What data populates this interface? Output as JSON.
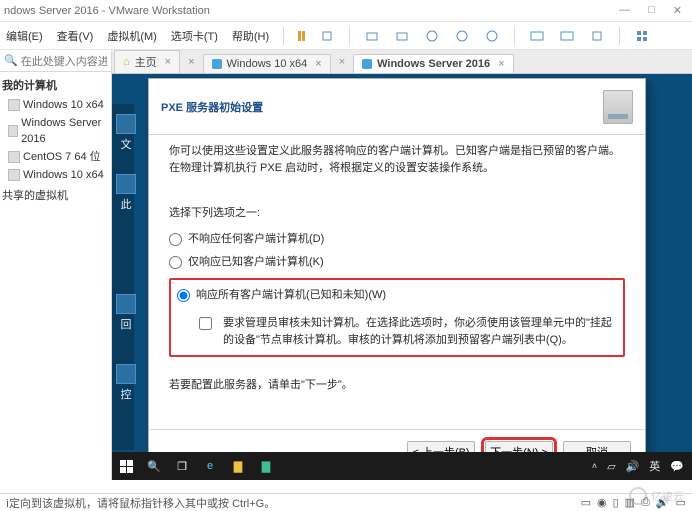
{
  "window": {
    "title": "ndows Server 2016 - VMware Workstation"
  },
  "menu": {
    "edit": "编辑(E)",
    "view": "查看(V)",
    "vm": "虚拟机(M)",
    "tabs": "选项卡(T)",
    "help": "帮助(H)"
  },
  "search": {
    "placeholder": "在此处键入内容进行搜索"
  },
  "tree": {
    "header": "我的计算机",
    "items": [
      {
        "label": "Windows 10 x64"
      },
      {
        "label": "Windows Server 2016"
      },
      {
        "label": "CentOS 7 64 位"
      },
      {
        "label": "Windows 10 x64"
      }
    ],
    "shared": "共享的虚拟机"
  },
  "tabs": {
    "home": "主页",
    "t1": "Windows 10 x64",
    "t2": "Windows Server 2016"
  },
  "wizard": {
    "title": "PXE 服务器初始设置",
    "description": "你可以使用这些设置定义此服务器将响应的客户端计算机。已知客户端是指已预留的客户端。在物理计算机执行 PXE 启动时，将根据定义的设置安装操作系统。",
    "choose": "选择下列选项之一:",
    "opt1": "不响应任何客户端计算机(D)",
    "opt2": "仅响应已知客户端计算机(K)",
    "opt3": "响应所有客户端计算机(已知和未知)(W)",
    "sub": "要求管理员审核未知计算机。在选择此选项时，你必须使用该管理单元中的\"挂起的设备\"节点审核计算机。审核的计算机将添加到预留客户端列表中(Q)。",
    "config_line": "若要配置此服务器，请单击\"下一步\"。",
    "back": "< 上一步(B)",
    "next": "下一步(N) >",
    "cancel": "取消"
  },
  "taskbar": {
    "ime": "英"
  },
  "desktop_labels": {
    "a": "文",
    "b": "此",
    "c": "回",
    "d": "控"
  },
  "status": {
    "text": "ì定向到该虚拟机，请将鼠标指针移入其中或按 Ctrl+G。"
  },
  "watermark": {
    "text": "亿速云"
  }
}
